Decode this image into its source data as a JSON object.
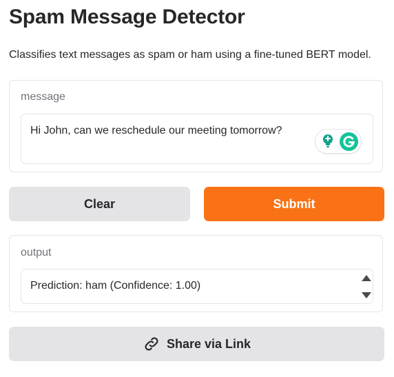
{
  "app": {
    "title": "Spam Message Detector",
    "description": "Classifies text messages as spam or ham using a fine-tuned BERT model."
  },
  "input": {
    "label": "message",
    "value": "Hi John, can we reschedule our meeting tomorrow?"
  },
  "actions": {
    "clear_label": "Clear",
    "submit_label": "Submit",
    "share_label": "Share via Link"
  },
  "output": {
    "label": "output",
    "value": "Prediction: ham (Confidence: 1.00)"
  },
  "colors": {
    "accent": "#f97316",
    "grammarly_green": "#15c39a",
    "grammarly_teal": "#0b7d71"
  },
  "icons": {
    "grammarly_suggestion": "lightbulb-icon",
    "grammarly_logo": "grammarly-logo-icon",
    "share": "link-icon",
    "scroll_up": "chevron-up-icon",
    "scroll_down": "chevron-down-icon"
  }
}
